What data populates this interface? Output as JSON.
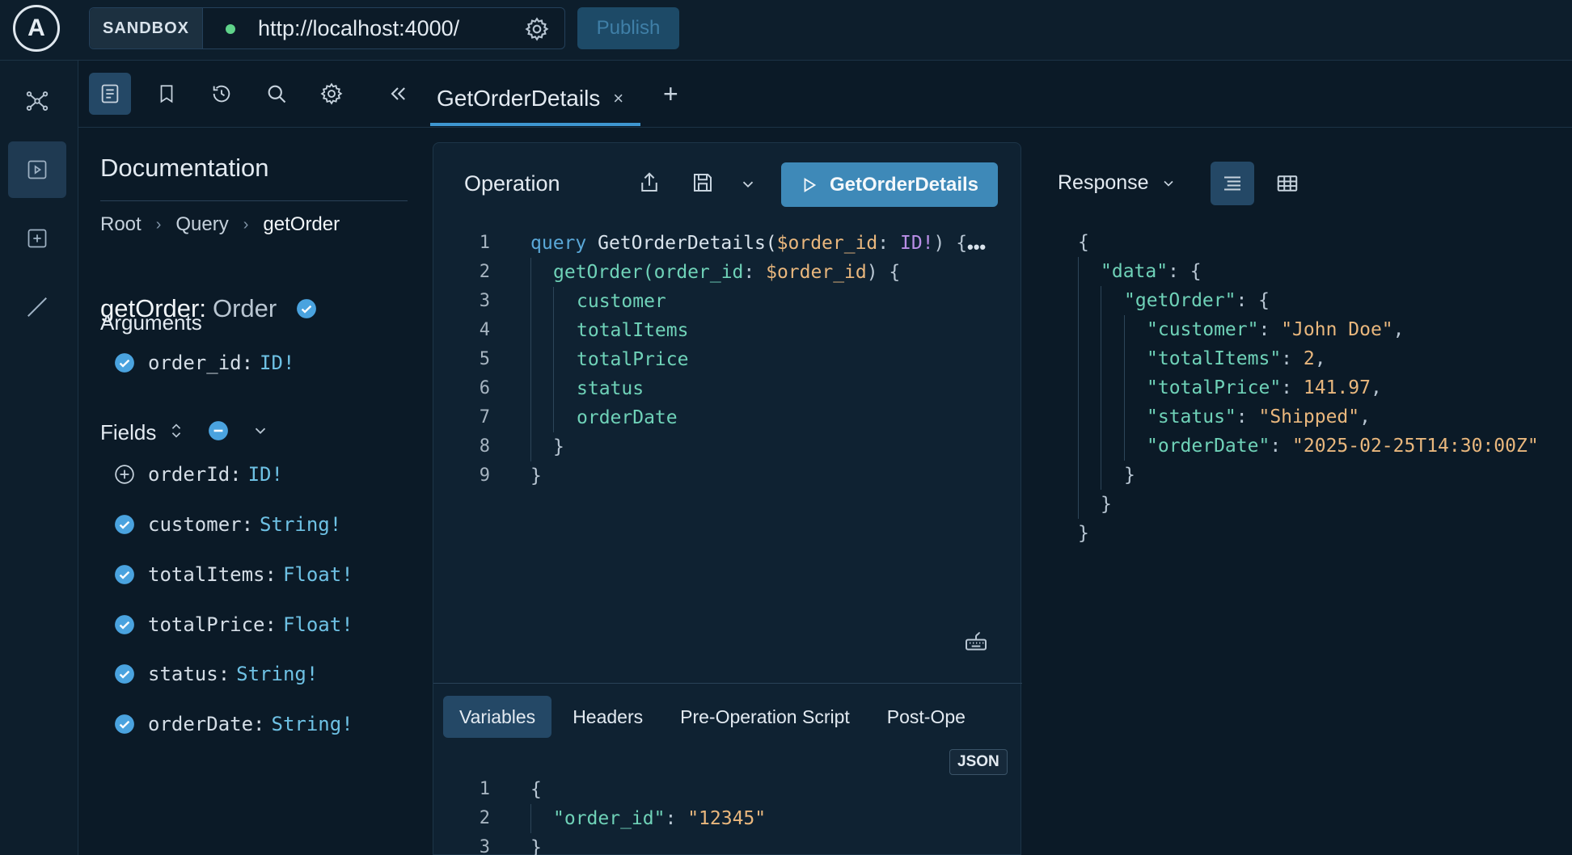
{
  "topbar": {
    "logo_letter": "A",
    "sandbox_label": "SANDBOX",
    "url": "http://localhost:4000/",
    "publish_label": "Publish"
  },
  "rail": {
    "icons": [
      "schema-graph-icon",
      "explorer-play-icon",
      "add-document-icon",
      "checks-icon"
    ]
  },
  "toolbar": {
    "icons": [
      "documentation-icon",
      "bookmark-icon",
      "history-icon",
      "search-icon",
      "settings-icon",
      "collapse-icon"
    ]
  },
  "tab": {
    "title": "GetOrderDetails",
    "close": "×",
    "add": "+"
  },
  "docs": {
    "title": "Documentation",
    "breadcrumb": [
      "Root",
      "Query",
      "getOrder"
    ],
    "field_name": "getOrder:",
    "field_type": "Order",
    "arguments_heading": "Arguments",
    "arguments": [
      {
        "name": "order_id:",
        "type": "ID!"
      }
    ],
    "fields_heading": "Fields",
    "fields": [
      {
        "name": "orderId:",
        "type": "ID!",
        "selected": false
      },
      {
        "name": "customer:",
        "type": "String!",
        "selected": true
      },
      {
        "name": "totalItems:",
        "type": "Float!",
        "selected": true
      },
      {
        "name": "totalPrice:",
        "type": "Float!",
        "selected": true
      },
      {
        "name": "status:",
        "type": "String!",
        "selected": true
      },
      {
        "name": "orderDate:",
        "type": "String!",
        "selected": true
      }
    ]
  },
  "operation": {
    "title": "Operation",
    "run_label": "GetOrderDetails",
    "more": "•••",
    "line_numbers": [
      "1",
      "2",
      "3",
      "4",
      "5",
      "6",
      "7",
      "8",
      "9"
    ],
    "code": {
      "l1_kw": "query",
      "l1_name": " GetOrderDetails(",
      "l1_var": "$order_id",
      "l1_colon": ": ",
      "l1_type": "ID!",
      "l1_end": ") {",
      "l2_fn": "getOrder(",
      "l2_arg": "order_id",
      "l2_colon": ": ",
      "l2_var": "$order_id",
      "l2_end": ") {",
      "l3": "customer",
      "l4": "totalItems",
      "l5": "totalPrice",
      "l6": "status",
      "l7": "orderDate",
      "l8": "}",
      "l9": "}"
    },
    "tabs": [
      "Variables",
      "Headers",
      "Pre-Operation Script",
      "Post-Ope"
    ],
    "json_badge": "JSON",
    "variables": {
      "line_numbers": [
        "1",
        "2",
        "3"
      ],
      "open": "{",
      "key": "\"order_id\"",
      "colon": ": ",
      "value": "\"12345\"",
      "close": "}"
    }
  },
  "response": {
    "title": "Response",
    "lines": {
      "open": "{",
      "data_key": "\"data\"",
      "data_open": ": {",
      "getorder_key": "\"getOrder\"",
      "getorder_open": ": {",
      "customer_key": "\"customer\"",
      "customer_val": "\"John Doe\"",
      "totalitems_key": "\"totalItems\"",
      "totalitems_val": "2",
      "totalprice_key": "\"totalPrice\"",
      "totalprice_val": "141.97",
      "status_key": "\"status\"",
      "status_val": "\"Shipped\"",
      "orderdate_key": "\"orderDate\"",
      "orderdate_val": "\"2025-02-25T14:30:00Z\"",
      "close1": "}",
      "close2": "}",
      "close3": "}"
    }
  },
  "colors": {
    "background": "#0b1a27",
    "accent": "#3e89b8",
    "check_blue": "#4aa3df",
    "field_green": "#6fd2b8",
    "string_orange": "#e9b77d",
    "type_purple": "#b98ee6"
  }
}
